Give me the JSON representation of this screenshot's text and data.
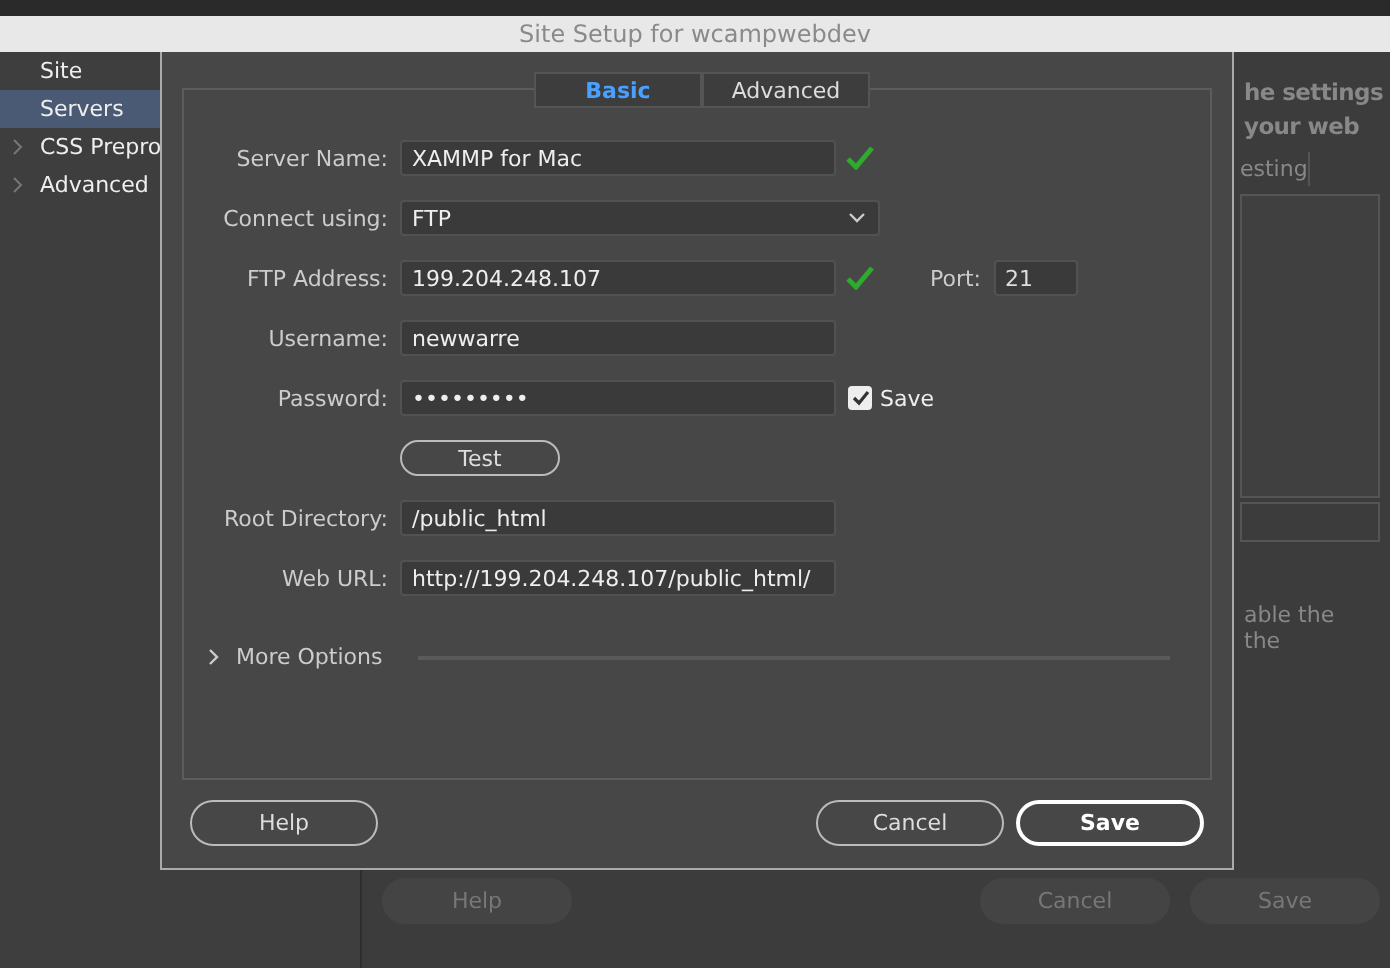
{
  "window": {
    "title": "Site Setup for wcampwebdev"
  },
  "sidebar": {
    "items": [
      {
        "label": "Site",
        "selected": false,
        "expandable": false
      },
      {
        "label": "Servers",
        "selected": true,
        "expandable": false
      },
      {
        "label": "CSS Prepro",
        "selected": false,
        "expandable": true
      },
      {
        "label": "Advanced",
        "selected": false,
        "expandable": true
      }
    ]
  },
  "background_panel": {
    "heading_lines": [
      "he settings",
      "your web"
    ],
    "tab": "esting",
    "note_lines": [
      "able the",
      "the"
    ],
    "buttons": [
      {
        "label": "Help",
        "disabled": true
      },
      {
        "label": "Cancel",
        "disabled": true
      },
      {
        "label": "Save",
        "disabled": true
      }
    ]
  },
  "dialog": {
    "tabs": [
      {
        "label": "Basic",
        "selected": true
      },
      {
        "label": "Advanced",
        "selected": false
      }
    ],
    "fields": [
      {
        "kind": "text",
        "label": "Server Name:",
        "value": "XAMMP for Mac",
        "valid": true
      },
      {
        "kind": "select",
        "label": "Connect using:",
        "value": "FTP"
      },
      {
        "kind": "text",
        "label": "FTP Address:",
        "value": "199.204.248.107",
        "valid": true,
        "port_label": "Port:",
        "port_value": "21"
      },
      {
        "kind": "text",
        "label": "Username:",
        "value": "newwarre",
        "valid": false
      },
      {
        "kind": "password",
        "label": "Password:",
        "value": "•••••••••",
        "save_label": "Save",
        "save_checked": true
      },
      {
        "kind": "button",
        "label": "Test"
      },
      {
        "kind": "text",
        "label": "Root Directory:",
        "value": "/public_html",
        "valid": false
      },
      {
        "kind": "text",
        "label": "Web URL:",
        "value": "http://199.204.248.107/public_html/",
        "valid": false
      }
    ],
    "more_options": {
      "label": "More Options",
      "expanded": false
    },
    "buttons": [
      {
        "label": "Help",
        "primary": false
      },
      {
        "label": "Cancel",
        "primary": false
      },
      {
        "label": "Save",
        "primary": true
      }
    ]
  }
}
